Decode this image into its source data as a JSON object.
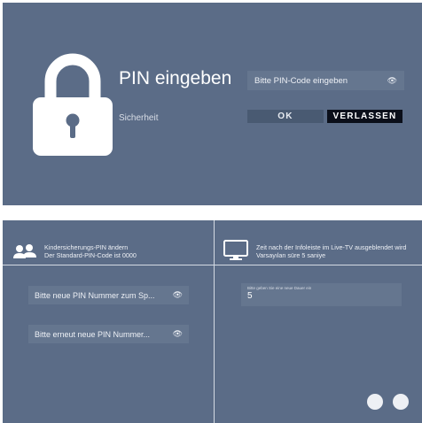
{
  "pin_dialog": {
    "title": "PIN eingeben",
    "subtitle": "Sicherheit",
    "pin_placeholder": "Bitte PIN-Code eingeben",
    "ok_label": "OK",
    "exit_label": "VERLASSEN"
  },
  "settings": {
    "parental_pin": {
      "title": "Kindersicherungs-PIN ändern",
      "description": "Der Standard-PIN-Code ist 0000",
      "new_pin_placeholder": "Bitte neue PIN Nummer zum Sp...",
      "confirm_pin_placeholder": "Bitte erneut neue PIN Nummer..."
    },
    "infobar_timeout": {
      "title": "Zeit nach der Infoleiste im Live-TV ausgeblendet wird",
      "description": "Varsayılan süre 5 saniye",
      "field_label": "Bitte geben Sie eine neue Dauer ein",
      "value": "5"
    }
  },
  "icons": {
    "lock": "lock-icon",
    "eye": "eye-icon",
    "people": "people-icon",
    "tv": "tv-icon"
  },
  "colors": {
    "panel_bg": "#5b6c87",
    "field_bg": "#65768f",
    "button_dark": "#0b0f1a",
    "button_muted": "#495a72"
  }
}
